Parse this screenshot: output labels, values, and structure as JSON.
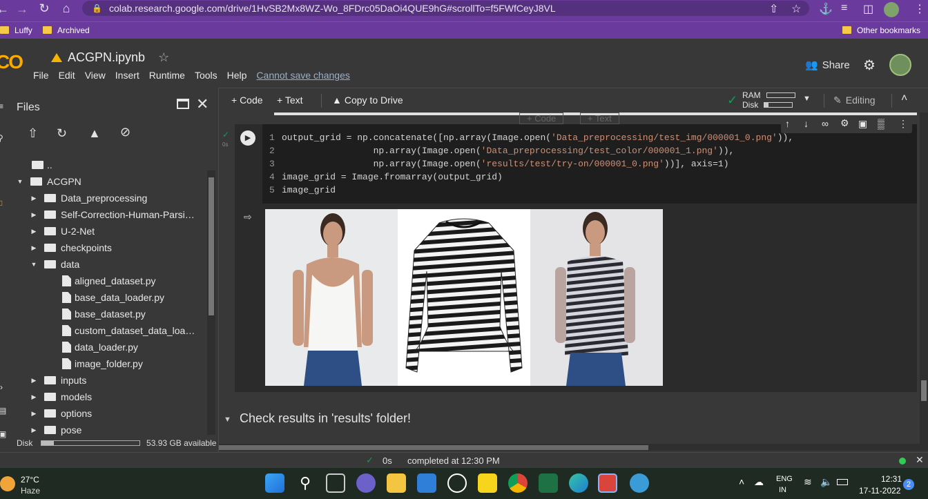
{
  "browser": {
    "url": "colab.research.google.com/drive/1HvSB2Mx8WZ-Wo_8FDrc05DaOi4QUE9hG#scrollTo=f5FWfCeyJ8VL",
    "bookmarks": [
      "Luffy",
      "Archived"
    ],
    "other_bookmarks": "Other bookmarks"
  },
  "colab": {
    "logo": "CO",
    "notebook_title": "ACGPN.ipynb",
    "menu": [
      "File",
      "Edit",
      "View",
      "Insert",
      "Runtime",
      "Tools",
      "Help"
    ],
    "cannot_save": "Cannot save changes",
    "share": "Share",
    "toolbar": {
      "code": "+ Code",
      "text": "+ Text",
      "copy_drive": "Copy to Drive",
      "ram": "RAM",
      "disk": "Disk",
      "editing": "Editing"
    },
    "ghost": {
      "code": "+ Code",
      "text": "+ Text"
    }
  },
  "sidebar": {
    "title": "Files",
    "tree": [
      {
        "label": "..",
        "indent": 0,
        "type": "up"
      },
      {
        "label": "ACGPN",
        "indent": 0,
        "type": "folder",
        "open": true
      },
      {
        "label": "Data_preprocessing",
        "indent": 1,
        "type": "folder"
      },
      {
        "label": "Self-Correction-Human-Parsi…",
        "indent": 1,
        "type": "folder"
      },
      {
        "label": "U-2-Net",
        "indent": 1,
        "type": "folder"
      },
      {
        "label": "checkpoints",
        "indent": 1,
        "type": "folder"
      },
      {
        "label": "data",
        "indent": 1,
        "type": "folder",
        "open": true
      },
      {
        "label": "aligned_dataset.py",
        "indent": 2,
        "type": "file"
      },
      {
        "label": "base_data_loader.py",
        "indent": 2,
        "type": "file"
      },
      {
        "label": "base_dataset.py",
        "indent": 2,
        "type": "file"
      },
      {
        "label": "custom_dataset_data_loa…",
        "indent": 2,
        "type": "file"
      },
      {
        "label": "data_loader.py",
        "indent": 2,
        "type": "file"
      },
      {
        "label": "image_folder.py",
        "indent": 2,
        "type": "file"
      },
      {
        "label": "inputs",
        "indent": 1,
        "type": "folder"
      },
      {
        "label": "models",
        "indent": 1,
        "type": "folder"
      },
      {
        "label": "options",
        "indent": 1,
        "type": "folder"
      },
      {
        "label": "pose",
        "indent": 1,
        "type": "folder"
      }
    ],
    "disk_label": "Disk",
    "disk_available": "53.93 GB available",
    "disk_used_fraction": 0.13
  },
  "cell": {
    "exec_count": "0s",
    "code_lines": [
      {
        "n": "1",
        "text": "output_grid = np.concatenate([np.array(Image.open(",
        "str": "'Data_preprocessing/test_img/000001_0.png'",
        "tail": ")),"
      },
      {
        "n": "2",
        "text": "                 np.array(Image.open(",
        "str": "'Data_preprocessing/test_color/000001_1.png'",
        "tail": ")),"
      },
      {
        "n": "3",
        "text": "                 np.array(Image.open(",
        "str": "'results/test/try-on/000001_0.png'",
        "tail": "))], axis=1)"
      },
      {
        "n": "4",
        "text": "image_grid = Image.fromarray(output_grid)",
        "str": "",
        "tail": ""
      },
      {
        "n": "5",
        "text": "image_grid",
        "str": "",
        "tail": ""
      }
    ]
  },
  "markdown_heading": "Check results in 'results' folder!",
  "status": {
    "time": "0s",
    "completed": "completed at 12:30 PM"
  },
  "taskbar": {
    "temp": "27°C",
    "weather": "Haze",
    "lang1": "ENG",
    "lang2": "IN",
    "clock": "12:31",
    "date": "17-11-2022",
    "notif_count": "2"
  },
  "colors": {
    "accent": "#f9ab00",
    "chrome": "#6a3b9d",
    "ok": "#0f9d58"
  }
}
